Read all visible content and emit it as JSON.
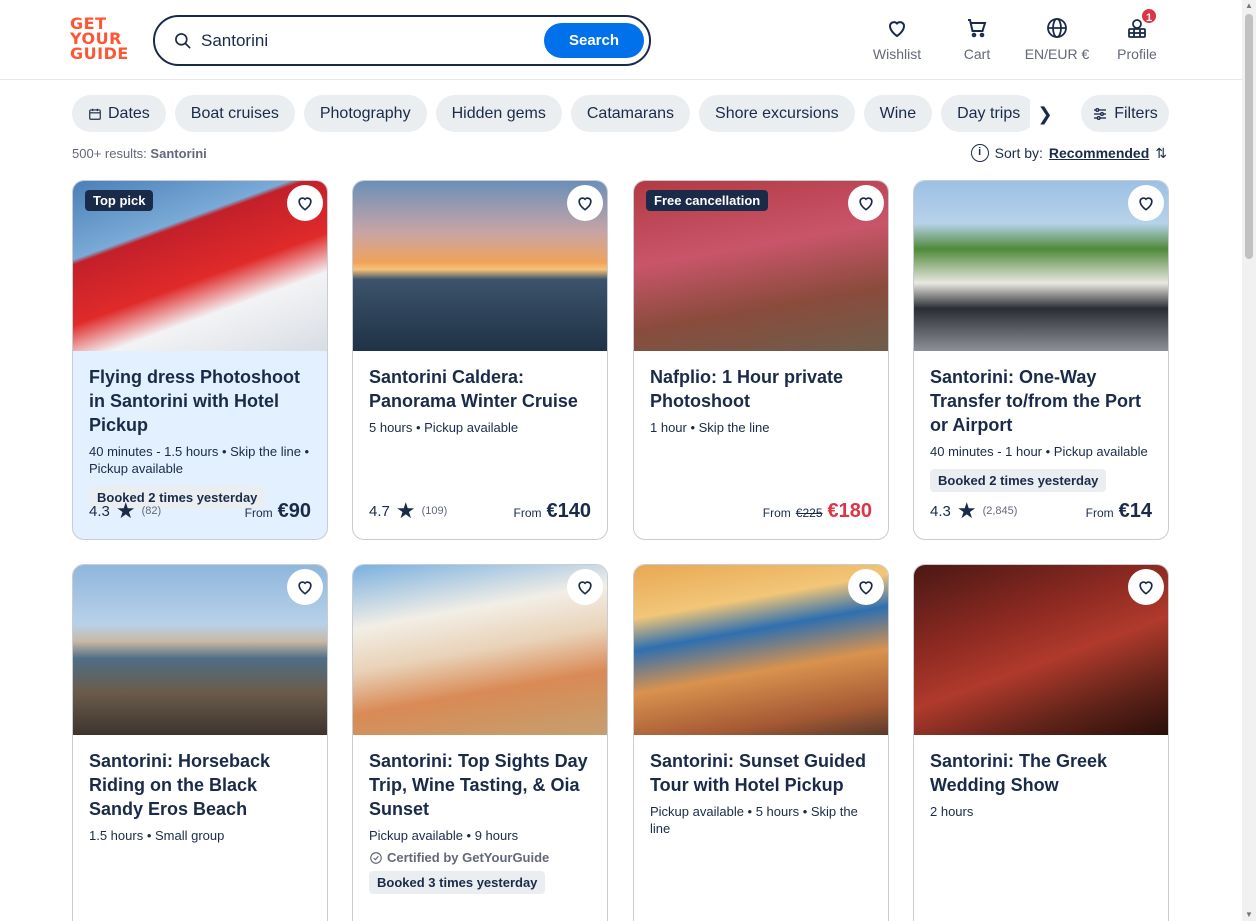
{
  "logo": {
    "line1": "GET",
    "line2": "YOUR",
    "line3": "GUIDE",
    "color": "#ff5533"
  },
  "search": {
    "value": "Santorini",
    "button": "Search"
  },
  "nav": {
    "wishlist": "Wishlist",
    "cart": "Cart",
    "locale": "EN/EUR €",
    "profile": "Profile",
    "profile_badge": "1"
  },
  "chips": [
    "Dates",
    "Boat cruises",
    "Photography",
    "Hidden gems",
    "Catamarans",
    "Shore excursions",
    "Wine",
    "Day trips"
  ],
  "filters": "Filters",
  "results": {
    "count": "500+ results:",
    "query": "Santorini"
  },
  "sort": {
    "label": "Sort by:",
    "value": "Recommended"
  },
  "cards": [
    {
      "tag": "Top pick",
      "title": "Flying dress Photoshoot in Santorini with Hotel Pickup",
      "meta": "40 minutes - 1.5 hours • Skip the line • Pickup available",
      "booked": "Booked 2 times yesterday",
      "rating": "4.3",
      "reviews": "(82)",
      "from": "From",
      "price": "€90"
    },
    {
      "title": "Santorini Caldera: Panorama Winter Cruise",
      "meta": "5 hours • Pickup available",
      "rating": "4.7",
      "reviews": "(109)",
      "from": "From",
      "price": "€140"
    },
    {
      "tag": "Free cancellation",
      "title": "Nafplio: 1 Hour private Photoshoot",
      "meta": "1 hour • Skip the line",
      "from": "From",
      "old_price": "€225",
      "price": "€180"
    },
    {
      "title": "Santorini: One-Way Transfer to/from the Port or Airport",
      "meta": "40 minutes - 1 hour • Pickup available",
      "booked": "Booked 2 times yesterday",
      "rating": "4.3",
      "reviews": "(2,845)",
      "from": "From",
      "price": "€14"
    },
    {
      "title": "Santorini: Horseback Riding on the Black Sandy Eros Beach",
      "meta": "1.5 hours • Small group"
    },
    {
      "title": "Santorini: Top Sights Day Trip, Wine Tasting, & Oia Sunset",
      "meta": "Pickup available • 9 hours",
      "cert": "Certified by GetYourGuide",
      "booked": "Booked 3 times yesterday"
    },
    {
      "title": "Santorini: Sunset Guided Tour with Hotel Pickup",
      "meta": "Pickup available • 5 hours • Skip the line"
    },
    {
      "title": "Santorini: The Greek Wedding Show",
      "meta": "2 hours"
    }
  ],
  "colors": {
    "primary": "#0071eb",
    "text": "#1a2b49",
    "sale": "#dc3545",
    "highlight": "#e3f0ff"
  }
}
